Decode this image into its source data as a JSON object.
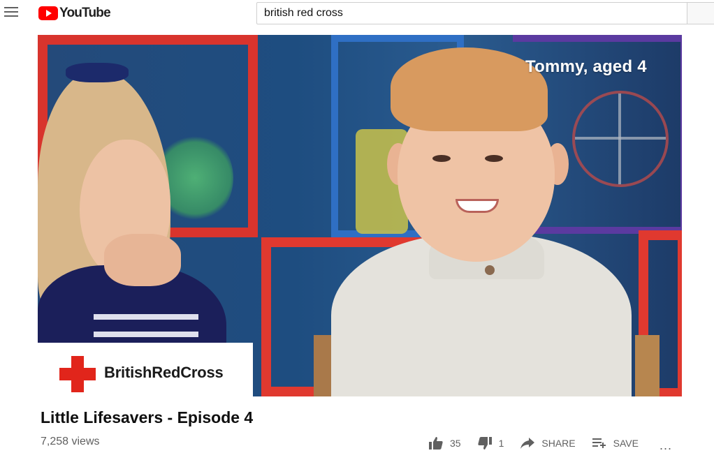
{
  "header": {
    "logo_text": "YouTube",
    "search_value": "british red cross"
  },
  "video": {
    "caption": "Tommy, aged 4",
    "brand_card": {
      "name": "BritishRedCross",
      "cross_color": "#e1251b"
    }
  },
  "details": {
    "title": "Little Lifesavers - Episode 4",
    "views": "7,258 views",
    "likes": "35",
    "dislikes": "1",
    "share_label": "SHARE",
    "save_label": "SAVE",
    "more_label": "..."
  },
  "icons": [
    "menu-icon",
    "youtube-play-icon",
    "thumbs-up-icon",
    "thumbs-down-icon",
    "share-icon",
    "save-playlist-icon",
    "more-icon"
  ],
  "colors": {
    "brand_red": "#ff0000",
    "secondary_text": "#606060"
  }
}
